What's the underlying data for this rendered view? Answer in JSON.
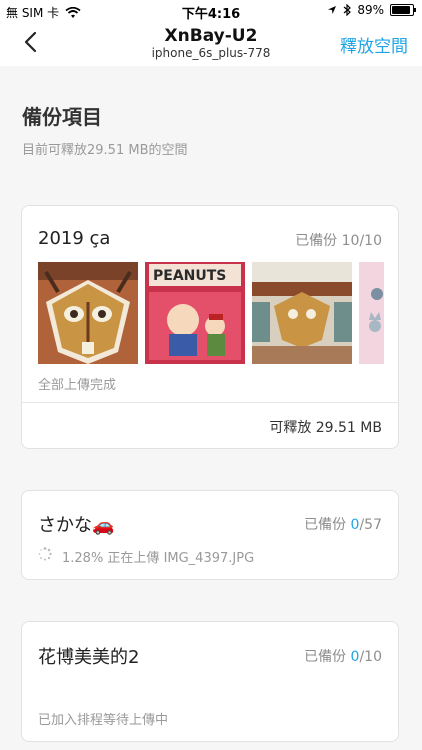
{
  "status_bar": {
    "carrier": "無 SIM 卡",
    "time": "下午4:16",
    "battery": "89%",
    "battery_level": 0.89
  },
  "nav": {
    "title": "XnBay-U2",
    "subtitle": "iphone_6s_plus-778",
    "action": "釋放空間"
  },
  "header": {
    "title": "備份項目",
    "subtitle": "目前可釋放29.51 MB的空間"
  },
  "albums": [
    {
      "name": "2019 ça",
      "backed_up_label": "已備份",
      "backed_up": "10",
      "total": "/10",
      "status": "全部上傳完成",
      "reclaimable": "可釋放 29.51 MB"
    },
    {
      "name": "さかな🚗",
      "backed_up_label": "已備份",
      "backed_up": "0",
      "total": "/57",
      "status": "1.28% 正在上傳 IMG_4397.JPG"
    },
    {
      "name": "花博美美的2",
      "backed_up_label": "已備份",
      "backed_up": "0",
      "total": "/10",
      "status": "已加入排程等待上傳中"
    }
  ],
  "thumbnail_text": "PEANUTS",
  "colors": {
    "accent": "#1fa5e6",
    "muted": "#9a9a9a",
    "background": "#f6f6f6"
  }
}
